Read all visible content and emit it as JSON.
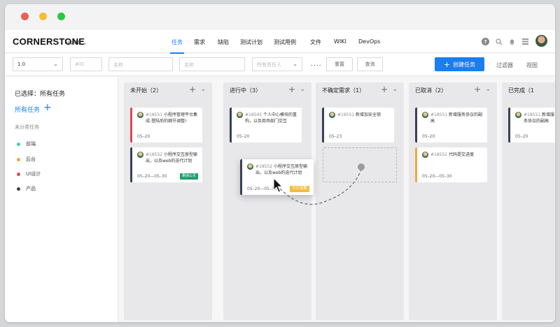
{
  "app": {
    "brand": "CORNERSTONE",
    "project": "app项目"
  },
  "nav": [
    "任务",
    "需求",
    "缺陷",
    "测试计划",
    "测试用例",
    "文件",
    "WIKI",
    "DevOps"
  ],
  "filters": {
    "version": "1.0",
    "id_placeholder": "#ID",
    "name1_placeholder": "名称",
    "name2_placeholder": "名称",
    "owner_placeholder": "所有责任人",
    "more": "....",
    "reset": "重置",
    "query": "查询",
    "create": "创建任务",
    "filter": "过滤器",
    "view": "视图"
  },
  "sidebar": {
    "selected": "已选择：所有任务",
    "all": "所有任务",
    "uncategorized": "未分类任务",
    "items": [
      {
        "label": "前端",
        "color": "#3ecfb5"
      },
      {
        "label": "后台",
        "color": "#f2a93b"
      },
      {
        "label": "UI设计",
        "color": "#d64a5a"
      },
      {
        "label": "产品",
        "color": "#3a4155"
      }
    ]
  },
  "columns": [
    {
      "title": "未开始（2）"
    },
    {
      "title": "进行中（3）"
    },
    {
      "title": "不确定需求（1）"
    },
    {
      "title": "已取消（2）"
    },
    {
      "title": "已完成（1"
    }
  ],
  "cards": [
    {
      "id": "#18551",
      "text": " 小程序管理平台集成-登陆后的细节调整!",
      "date": "05–20",
      "color": "#d64a5a"
    },
    {
      "id": "#18552",
      "text": " 小程序交互原型输出，以及web的迭代计划",
      "date": "05–20—05–30",
      "badge": "剩余1天",
      "badge_color": "#1f9e6e",
      "color": "#3a4155"
    },
    {
      "id": "#18545",
      "text": " 个人中心模块的重构，以及商场部门交互",
      "date": "05–20",
      "color": "#3a4155"
    },
    {
      "id": "#18551",
      "text": " 新增加安全锁",
      "date": "05–23",
      "color": "#3a4155"
    },
    {
      "id": "#18551",
      "text": " 新增服务协议的副高",
      "date": "05–20",
      "color": "#3a4155"
    },
    {
      "id": "#18552",
      "text": " 代码提交进度",
      "date": "05–20—05–30",
      "color": "#f2a93b"
    },
    {
      "id": "#18551",
      "text": " 新增服务协议的副高",
      "date": "05–20",
      "color": "#3a4155"
    }
  ],
  "drag_card": {
    "id": "#18552",
    "text": " 小程序交互原型输出，以及web的迭代计划",
    "date": "05–20—05–30",
    "badge": "今天到期",
    "badge_color": "#f2bc3a"
  }
}
